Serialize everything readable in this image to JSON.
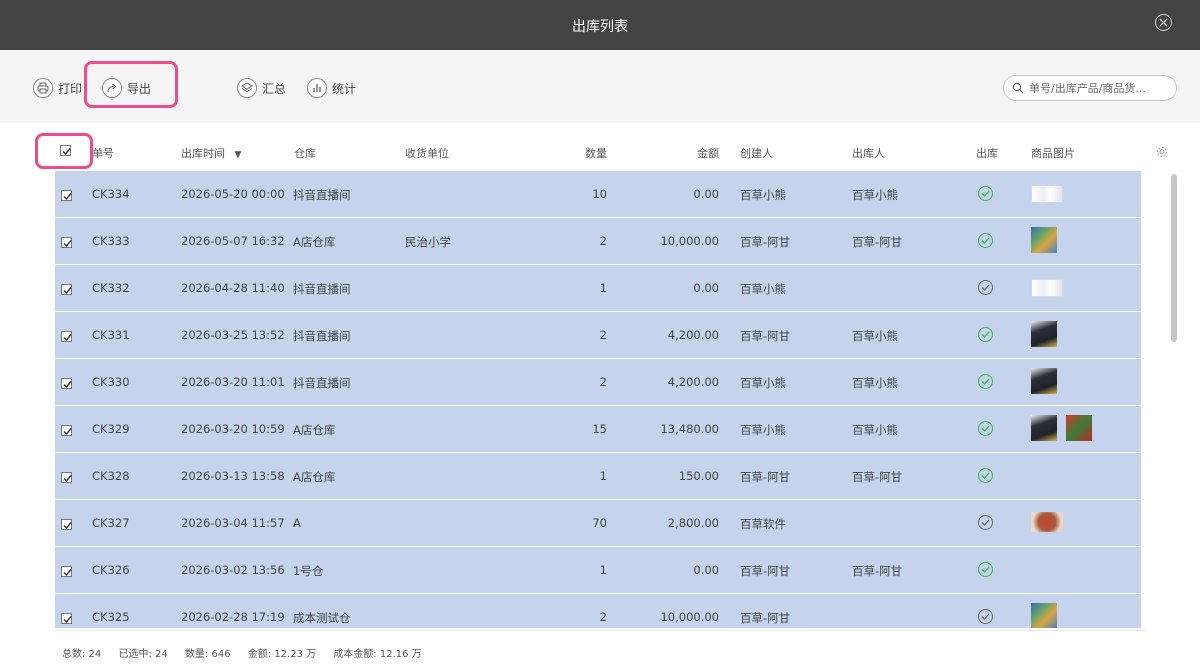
{
  "window": {
    "title": "出库列表",
    "close_icon": "close-circle-icon"
  },
  "toolbar": {
    "print_label": "打印",
    "export_label": "导出",
    "summary_label": "汇总",
    "stats_label": "统计",
    "search_placeholder": "单号/出库产品/商品货...",
    "highlight_color": "#f04b8c"
  },
  "table": {
    "columns": [
      "单号",
      "出库时间",
      "仓库",
      "收货单位",
      "数量",
      "金额",
      "创建人",
      "出库人",
      "出库",
      "商品图片"
    ],
    "sort_indicator": "▼",
    "row_color": "#c5d3ec",
    "rows": [
      {
        "no": "CK334",
        "time": "2026-05-20 00:00",
        "warehouse": "抖音直播间",
        "receiver": "",
        "qty": "10",
        "amount": "0.00",
        "creator": "百草小熊",
        "outbound_by": "百草小熊",
        "status": "green",
        "images": [
          "paper-product"
        ]
      },
      {
        "no": "CK333",
        "time": "2026-05-07 16:32",
        "warehouse": "A店仓库",
        "receiver": "民治小学",
        "qty": "2",
        "amount": "10,000.00",
        "creator": "百草-阿甘",
        "outbound_by": "百草-阿甘",
        "status": "green",
        "images": [
          "colorful-box"
        ]
      },
      {
        "no": "CK332",
        "time": "2026-04-28 11:40",
        "warehouse": "抖音直播间",
        "receiver": "",
        "qty": "1",
        "amount": "0.00",
        "creator": "百草小熊",
        "outbound_by": "",
        "status": "grey",
        "images": [
          "paper-product"
        ]
      },
      {
        "no": "CK331",
        "time": "2026-03-25 13:52",
        "warehouse": "抖音直播间",
        "receiver": "",
        "qty": "2",
        "amount": "4,200.00",
        "creator": "百草-阿甘",
        "outbound_by": "百草小熊",
        "status": "green",
        "images": [
          "dark-device"
        ]
      },
      {
        "no": "CK330",
        "time": "2026-03-20 11:01",
        "warehouse": "抖音直播间",
        "receiver": "",
        "qty": "2",
        "amount": "4,200.00",
        "creator": "百草小熊",
        "outbound_by": "百草小熊",
        "status": "green",
        "images": [
          "dark-device"
        ]
      },
      {
        "no": "CK329",
        "time": "2026-03-20 10:59",
        "warehouse": "A店仓库",
        "receiver": "",
        "qty": "15",
        "amount": "13,480.00",
        "creator": "百草小熊",
        "outbound_by": "百草小熊",
        "status": "green",
        "images": [
          "dark-device",
          "red-box"
        ]
      },
      {
        "no": "CK328",
        "time": "2026-03-13 13:58",
        "warehouse": "A店仓库",
        "receiver": "",
        "qty": "1",
        "amount": "150.00",
        "creator": "百草-阿甘",
        "outbound_by": "百草-阿甘",
        "status": "green",
        "images": []
      },
      {
        "no": "CK327",
        "time": "2026-03-04 11:57",
        "warehouse": "A",
        "receiver": "",
        "qty": "70",
        "amount": "2,800.00",
        "creator": "百草软件",
        "outbound_by": "",
        "status": "grey",
        "images": [
          "food-plate"
        ]
      },
      {
        "no": "CK326",
        "time": "2026-03-02 13:56",
        "warehouse": "1号仓",
        "receiver": "",
        "qty": "1",
        "amount": "0.00",
        "creator": "百草-阿甘",
        "outbound_by": "百草-阿甘",
        "status": "green",
        "images": []
      },
      {
        "no": "CK325",
        "time": "2026-02-28 17:19",
        "warehouse": "成本测试仓",
        "receiver": "",
        "qty": "2",
        "amount": "10,000.00",
        "creator": "百草-阿甘",
        "outbound_by": "",
        "status": "grey",
        "images": [
          "colorful-box"
        ]
      }
    ]
  },
  "footer": {
    "total": "总数: 24",
    "selected": "已选中: 24",
    "quantity": "数量: 646",
    "amount": "金额: 12.23 万",
    "cost": "成本金额: 12.16 万"
  }
}
